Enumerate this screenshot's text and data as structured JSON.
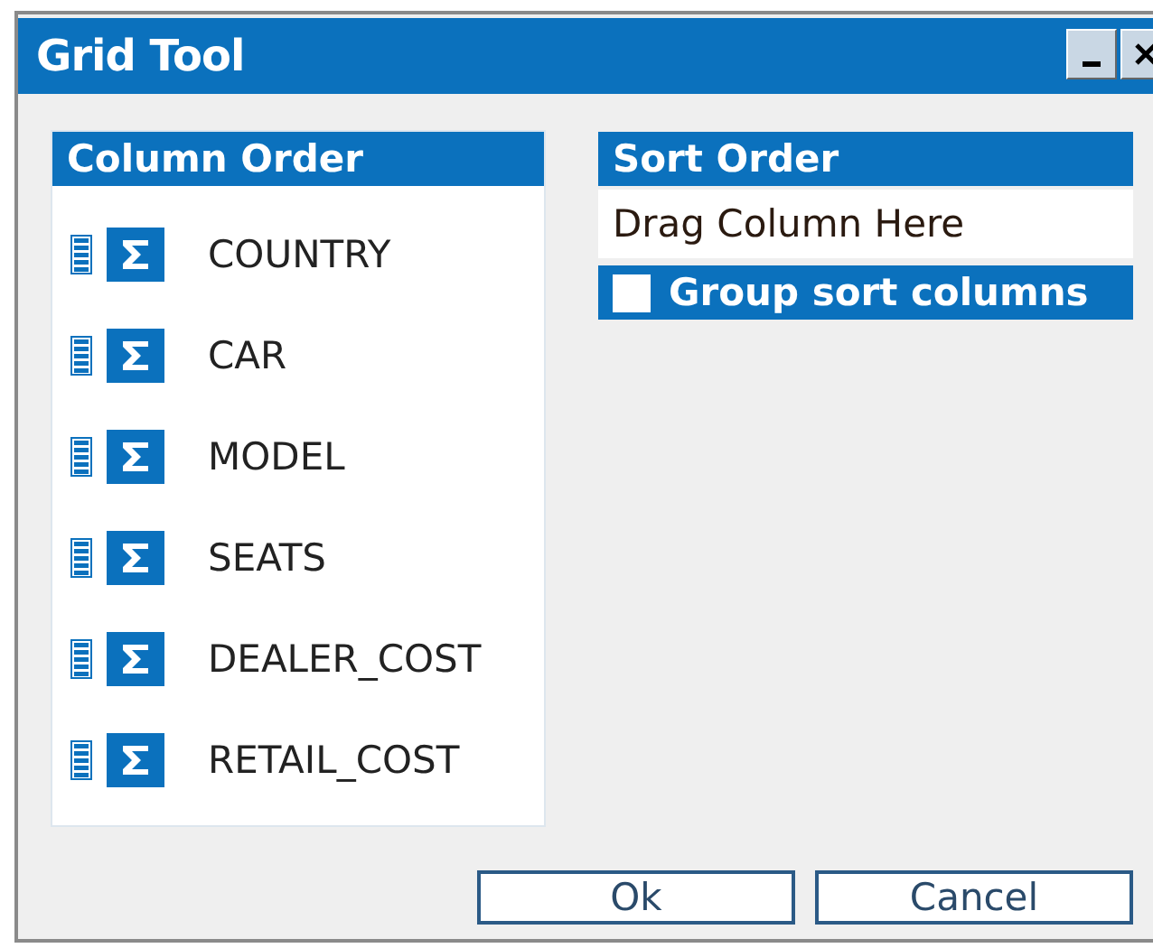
{
  "window": {
    "title": "Grid Tool"
  },
  "column_order": {
    "title": "Column Order",
    "columns": [
      {
        "name": "COUNTRY"
      },
      {
        "name": "CAR"
      },
      {
        "name": "MODEL"
      },
      {
        "name": "SEATS"
      },
      {
        "name": "DEALER_COST"
      },
      {
        "name": "RETAIL_COST"
      }
    ]
  },
  "sort_order": {
    "title": "Sort Order",
    "drop_hint": "Drag Column Here",
    "group_sort": {
      "label": "Group sort columns",
      "checked": false
    }
  },
  "buttons": [
    "Ok",
    "Cancel"
  ]
}
